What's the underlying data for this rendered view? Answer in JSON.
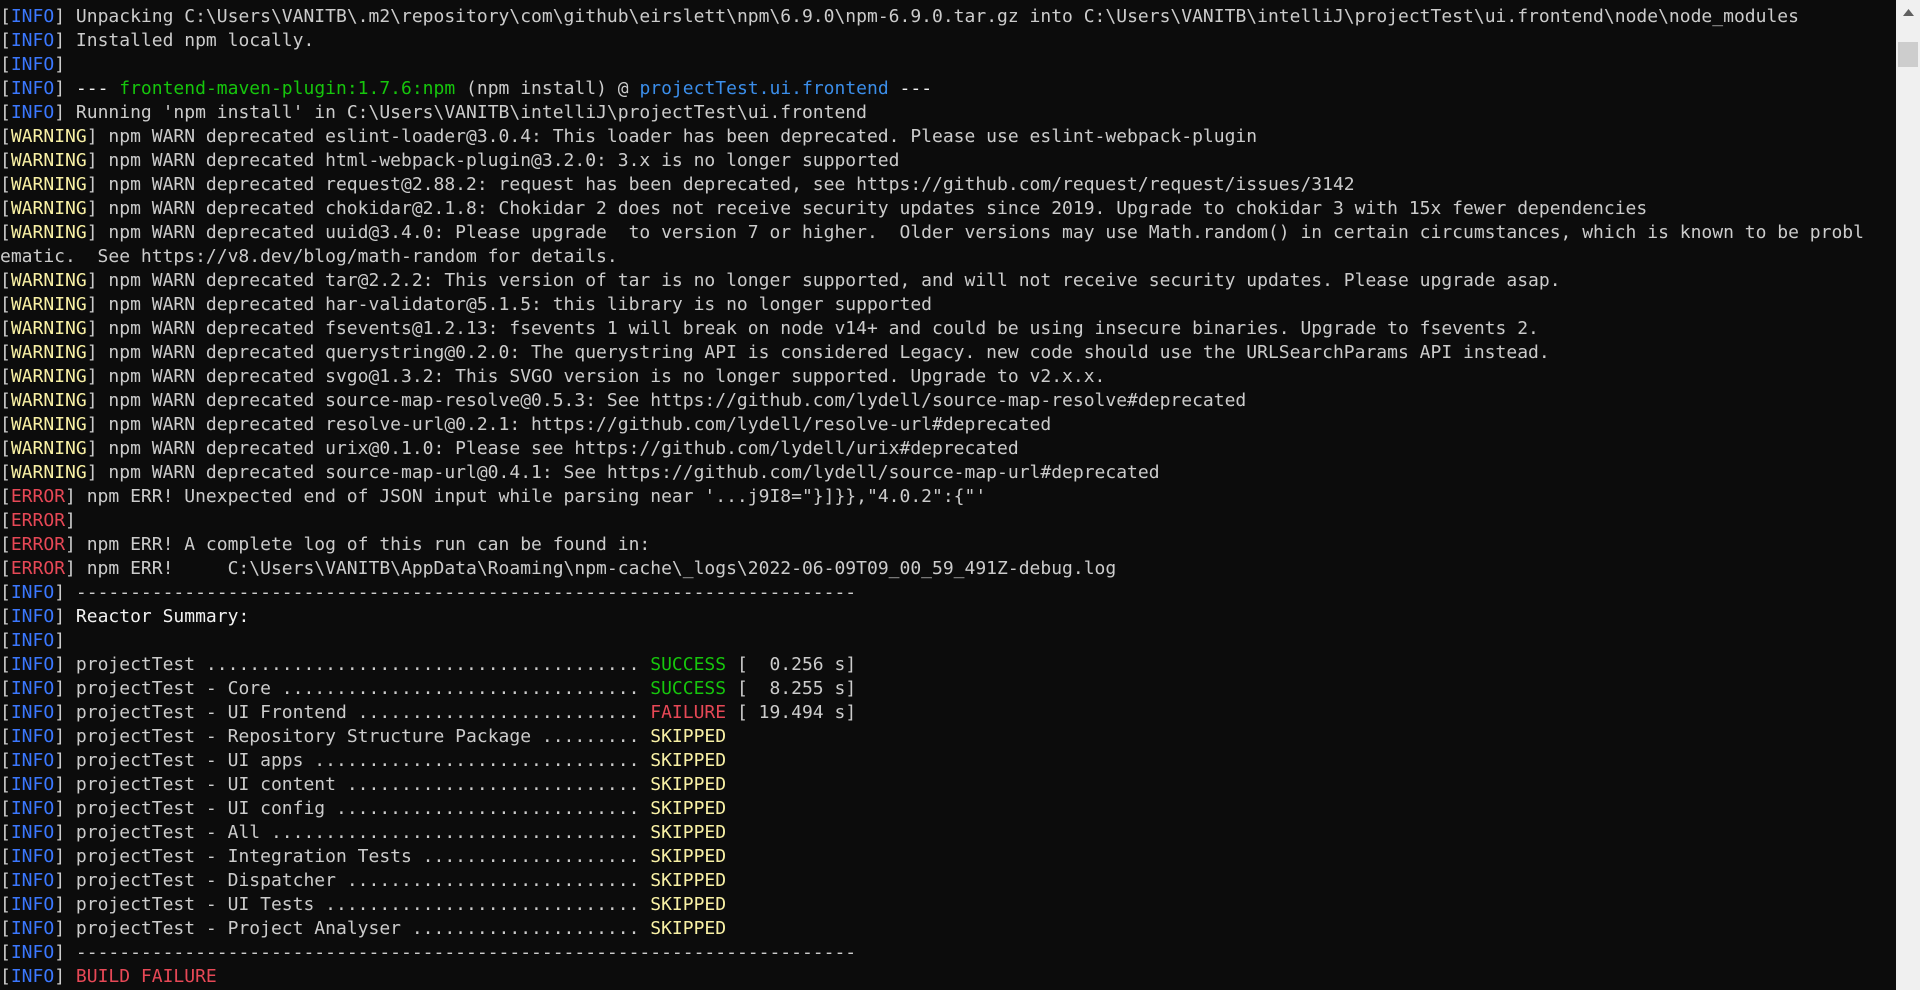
{
  "console": {
    "lines": [
      [
        {
          "t": "[",
          "c": "br"
        },
        {
          "t": "INFO",
          "c": "lv-info"
        },
        {
          "t": "] ",
          "c": "br"
        },
        {
          "t": "Unpacking C:\\Users\\VANITB\\.m2\\repository\\com\\github\\eirslett\\npm\\6.9.0\\npm-6.9.0.tar.gz into C:\\Users\\VANITB\\intelliJ\\projectTest\\ui.frontend\\node\\node_modules",
          "c": "plain"
        }
      ],
      [
        {
          "t": "[",
          "c": "br"
        },
        {
          "t": "INFO",
          "c": "lv-info"
        },
        {
          "t": "] ",
          "c": "br"
        },
        {
          "t": "Installed npm locally.",
          "c": "plain"
        }
      ],
      [
        {
          "t": "[",
          "c": "br"
        },
        {
          "t": "INFO",
          "c": "lv-info"
        },
        {
          "t": "]",
          "c": "br"
        }
      ],
      [
        {
          "t": "[",
          "c": "br"
        },
        {
          "t": "INFO",
          "c": "lv-info"
        },
        {
          "t": "] ",
          "c": "br"
        },
        {
          "t": "--- ",
          "c": "bold"
        },
        {
          "t": "frontend-maven-plugin:1.7.6:npm",
          "c": "green"
        },
        {
          "t": " (npm install) @ ",
          "c": "plain"
        },
        {
          "t": "projectTest.ui.frontend",
          "c": "cyan"
        },
        {
          "t": " ---",
          "c": "bold"
        }
      ],
      [
        {
          "t": "[",
          "c": "br"
        },
        {
          "t": "INFO",
          "c": "lv-info"
        },
        {
          "t": "] ",
          "c": "br"
        },
        {
          "t": "Running 'npm install' in C:\\Users\\VANITB\\intelliJ\\projectTest\\ui.frontend",
          "c": "plain"
        }
      ],
      [
        {
          "t": "[",
          "c": "br"
        },
        {
          "t": "WARNING",
          "c": "lv-warn"
        },
        {
          "t": "] ",
          "c": "br"
        },
        {
          "t": "npm WARN deprecated eslint-loader@3.0.4: This loader has been deprecated. Please use eslint-webpack-plugin",
          "c": "plain"
        }
      ],
      [
        {
          "t": "[",
          "c": "br"
        },
        {
          "t": "WARNING",
          "c": "lv-warn"
        },
        {
          "t": "] ",
          "c": "br"
        },
        {
          "t": "npm WARN deprecated html-webpack-plugin@3.2.0: 3.x is no longer supported",
          "c": "plain"
        }
      ],
      [
        {
          "t": "[",
          "c": "br"
        },
        {
          "t": "WARNING",
          "c": "lv-warn"
        },
        {
          "t": "] ",
          "c": "br"
        },
        {
          "t": "npm WARN deprecated request@2.88.2: request has been deprecated, see https://github.com/request/request/issues/3142",
          "c": "plain"
        }
      ],
      [
        {
          "t": "[",
          "c": "br"
        },
        {
          "t": "WARNING",
          "c": "lv-warn"
        },
        {
          "t": "] ",
          "c": "br"
        },
        {
          "t": "npm WARN deprecated chokidar@2.1.8: Chokidar 2 does not receive security updates since 2019. Upgrade to chokidar 3 with 15x fewer dependencies",
          "c": "plain"
        }
      ],
      [
        {
          "t": "[",
          "c": "br"
        },
        {
          "t": "WARNING",
          "c": "lv-warn"
        },
        {
          "t": "] ",
          "c": "br"
        },
        {
          "t": "npm WARN deprecated uuid@3.4.0: Please upgrade  to version 7 or higher.  Older versions may use Math.random() in certain circumstances, which is known to be probl",
          "c": "plain"
        }
      ],
      [
        {
          "t": "ematic.  See https://v8.dev/blog/math-random for details.",
          "c": "plain"
        }
      ],
      [
        {
          "t": "[",
          "c": "br"
        },
        {
          "t": "WARNING",
          "c": "lv-warn"
        },
        {
          "t": "] ",
          "c": "br"
        },
        {
          "t": "npm WARN deprecated tar@2.2.2: This version of tar is no longer supported, and will not receive security updates. Please upgrade asap.",
          "c": "plain"
        }
      ],
      [
        {
          "t": "[",
          "c": "br"
        },
        {
          "t": "WARNING",
          "c": "lv-warn"
        },
        {
          "t": "] ",
          "c": "br"
        },
        {
          "t": "npm WARN deprecated har-validator@5.1.5: this library is no longer supported",
          "c": "plain"
        }
      ],
      [
        {
          "t": "[",
          "c": "br"
        },
        {
          "t": "WARNING",
          "c": "lv-warn"
        },
        {
          "t": "] ",
          "c": "br"
        },
        {
          "t": "npm WARN deprecated fsevents@1.2.13: fsevents 1 will break on node v14+ and could be using insecure binaries. Upgrade to fsevents 2.",
          "c": "plain"
        }
      ],
      [
        {
          "t": "[",
          "c": "br"
        },
        {
          "t": "WARNING",
          "c": "lv-warn"
        },
        {
          "t": "] ",
          "c": "br"
        },
        {
          "t": "npm WARN deprecated querystring@0.2.0: The querystring API is considered Legacy. new code should use the URLSearchParams API instead.",
          "c": "plain"
        }
      ],
      [
        {
          "t": "[",
          "c": "br"
        },
        {
          "t": "WARNING",
          "c": "lv-warn"
        },
        {
          "t": "] ",
          "c": "br"
        },
        {
          "t": "npm WARN deprecated svgo@1.3.2: This SVGO version is no longer supported. Upgrade to v2.x.x.",
          "c": "plain"
        }
      ],
      [
        {
          "t": "[",
          "c": "br"
        },
        {
          "t": "WARNING",
          "c": "lv-warn"
        },
        {
          "t": "] ",
          "c": "br"
        },
        {
          "t": "npm WARN deprecated source-map-resolve@0.5.3: See https://github.com/lydell/source-map-resolve#deprecated",
          "c": "plain"
        }
      ],
      [
        {
          "t": "[",
          "c": "br"
        },
        {
          "t": "WARNING",
          "c": "lv-warn"
        },
        {
          "t": "] ",
          "c": "br"
        },
        {
          "t": "npm WARN deprecated resolve-url@0.2.1: https://github.com/lydell/resolve-url#deprecated",
          "c": "plain"
        }
      ],
      [
        {
          "t": "[",
          "c": "br"
        },
        {
          "t": "WARNING",
          "c": "lv-warn"
        },
        {
          "t": "] ",
          "c": "br"
        },
        {
          "t": "npm WARN deprecated urix@0.1.0: Please see https://github.com/lydell/urix#deprecated",
          "c": "plain"
        }
      ],
      [
        {
          "t": "[",
          "c": "br"
        },
        {
          "t": "WARNING",
          "c": "lv-warn"
        },
        {
          "t": "] ",
          "c": "br"
        },
        {
          "t": "npm WARN deprecated source-map-url@0.4.1: See https://github.com/lydell/source-map-url#deprecated",
          "c": "plain"
        }
      ],
      [
        {
          "t": "[",
          "c": "br"
        },
        {
          "t": "ERROR",
          "c": "lv-error"
        },
        {
          "t": "] ",
          "c": "br"
        },
        {
          "t": "npm ERR! Unexpected end of JSON input while parsing near '...j9I8=\"}]}},\"4.0.2\":{\"'",
          "c": "plain"
        }
      ],
      [
        {
          "t": "[",
          "c": "br"
        },
        {
          "t": "ERROR",
          "c": "lv-error"
        },
        {
          "t": "]",
          "c": "br"
        }
      ],
      [
        {
          "t": "[",
          "c": "br"
        },
        {
          "t": "ERROR",
          "c": "lv-error"
        },
        {
          "t": "] ",
          "c": "br"
        },
        {
          "t": "npm ERR! A complete log of this run can be found in:",
          "c": "plain"
        }
      ],
      [
        {
          "t": "[",
          "c": "br"
        },
        {
          "t": "ERROR",
          "c": "lv-error"
        },
        {
          "t": "] ",
          "c": "br"
        },
        {
          "t": "npm ERR!     C:\\Users\\VANITB\\AppData\\Roaming\\npm-cache\\_logs\\2022-06-09T09_00_59_491Z-debug.log",
          "c": "plain"
        }
      ],
      [
        {
          "t": "[",
          "c": "br"
        },
        {
          "t": "INFO",
          "c": "lv-info"
        },
        {
          "t": "] ",
          "c": "br"
        },
        {
          "t": "------------------------------------------------------------------------",
          "c": "plain"
        }
      ],
      [
        {
          "t": "[",
          "c": "br"
        },
        {
          "t": "INFO",
          "c": "lv-info"
        },
        {
          "t": "] ",
          "c": "br"
        },
        {
          "t": "Reactor Summary:",
          "c": "bold"
        }
      ],
      [
        {
          "t": "[",
          "c": "br"
        },
        {
          "t": "INFO",
          "c": "lv-info"
        },
        {
          "t": "]",
          "c": "br"
        }
      ],
      [
        {
          "t": "[",
          "c": "br"
        },
        {
          "t": "INFO",
          "c": "lv-info"
        },
        {
          "t": "] ",
          "c": "br"
        },
        {
          "t": "projectTest ........................................ ",
          "c": "plain"
        },
        {
          "t": "SUCCESS",
          "c": "green"
        },
        {
          "t": " [  0.256 s]",
          "c": "plain"
        }
      ],
      [
        {
          "t": "[",
          "c": "br"
        },
        {
          "t": "INFO",
          "c": "lv-info"
        },
        {
          "t": "] ",
          "c": "br"
        },
        {
          "t": "projectTest - Core ................................. ",
          "c": "plain"
        },
        {
          "t": "SUCCESS",
          "c": "green"
        },
        {
          "t": " [  8.255 s]",
          "c": "plain"
        }
      ],
      [
        {
          "t": "[",
          "c": "br"
        },
        {
          "t": "INFO",
          "c": "lv-info"
        },
        {
          "t": "] ",
          "c": "br"
        },
        {
          "t": "projectTest - UI Frontend .......................... ",
          "c": "plain"
        },
        {
          "t": "FAILURE",
          "c": "red"
        },
        {
          "t": " [ 19.494 s]",
          "c": "plain"
        }
      ],
      [
        {
          "t": "[",
          "c": "br"
        },
        {
          "t": "INFO",
          "c": "lv-info"
        },
        {
          "t": "] ",
          "c": "br"
        },
        {
          "t": "projectTest - Repository Structure Package ......... ",
          "c": "plain"
        },
        {
          "t": "SKIPPED",
          "c": "yellow"
        }
      ],
      [
        {
          "t": "[",
          "c": "br"
        },
        {
          "t": "INFO",
          "c": "lv-info"
        },
        {
          "t": "] ",
          "c": "br"
        },
        {
          "t": "projectTest - UI apps .............................. ",
          "c": "plain"
        },
        {
          "t": "SKIPPED",
          "c": "yellow"
        }
      ],
      [
        {
          "t": "[",
          "c": "br"
        },
        {
          "t": "INFO",
          "c": "lv-info"
        },
        {
          "t": "] ",
          "c": "br"
        },
        {
          "t": "projectTest - UI content ........................... ",
          "c": "plain"
        },
        {
          "t": "SKIPPED",
          "c": "yellow"
        }
      ],
      [
        {
          "t": "[",
          "c": "br"
        },
        {
          "t": "INFO",
          "c": "lv-info"
        },
        {
          "t": "] ",
          "c": "br"
        },
        {
          "t": "projectTest - UI config ............................ ",
          "c": "plain"
        },
        {
          "t": "SKIPPED",
          "c": "yellow"
        }
      ],
      [
        {
          "t": "[",
          "c": "br"
        },
        {
          "t": "INFO",
          "c": "lv-info"
        },
        {
          "t": "] ",
          "c": "br"
        },
        {
          "t": "projectTest - All .................................. ",
          "c": "plain"
        },
        {
          "t": "SKIPPED",
          "c": "yellow"
        }
      ],
      [
        {
          "t": "[",
          "c": "br"
        },
        {
          "t": "INFO",
          "c": "lv-info"
        },
        {
          "t": "] ",
          "c": "br"
        },
        {
          "t": "projectTest - Integration Tests .................... ",
          "c": "plain"
        },
        {
          "t": "SKIPPED",
          "c": "yellow"
        }
      ],
      [
        {
          "t": "[",
          "c": "br"
        },
        {
          "t": "INFO",
          "c": "lv-info"
        },
        {
          "t": "] ",
          "c": "br"
        },
        {
          "t": "projectTest - Dispatcher ........................... ",
          "c": "plain"
        },
        {
          "t": "SKIPPED",
          "c": "yellow"
        }
      ],
      [
        {
          "t": "[",
          "c": "br"
        },
        {
          "t": "INFO",
          "c": "lv-info"
        },
        {
          "t": "] ",
          "c": "br"
        },
        {
          "t": "projectTest - UI Tests ............................. ",
          "c": "plain"
        },
        {
          "t": "SKIPPED",
          "c": "yellow"
        }
      ],
      [
        {
          "t": "[",
          "c": "br"
        },
        {
          "t": "INFO",
          "c": "lv-info"
        },
        {
          "t": "] ",
          "c": "br"
        },
        {
          "t": "projectTest - Project Analyser ..................... ",
          "c": "plain"
        },
        {
          "t": "SKIPPED",
          "c": "yellow"
        }
      ],
      [
        {
          "t": "[",
          "c": "br"
        },
        {
          "t": "INFO",
          "c": "lv-info"
        },
        {
          "t": "] ",
          "c": "br"
        },
        {
          "t": "------------------------------------------------------------------------",
          "c": "plain"
        }
      ],
      [
        {
          "t": "[",
          "c": "br"
        },
        {
          "t": "INFO",
          "c": "lv-info"
        },
        {
          "t": "] ",
          "c": "br"
        },
        {
          "t": "BUILD FAILURE",
          "c": "red"
        }
      ]
    ]
  },
  "colors": {
    "background": "#0c0c0c",
    "text": "#cccccc",
    "info": "#3b78ff",
    "warning": "#f9f1a5",
    "error": "#e74856",
    "success": "#16c60c",
    "project": "#3b8eea",
    "scrollbar_track": "#f0f0f0",
    "scrollbar_thumb": "#cdcdcd"
  },
  "scrollbar": {
    "up_icon": "triangle-up-icon",
    "scroll_position": 0.03
  }
}
